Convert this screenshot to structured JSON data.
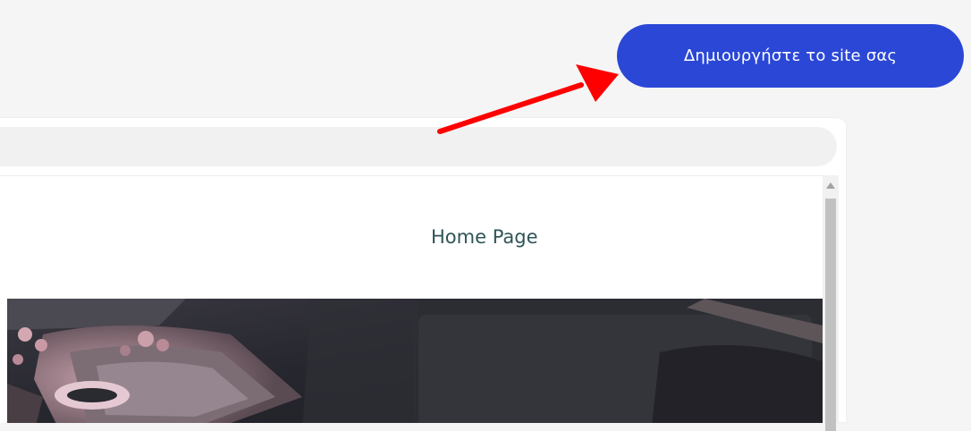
{
  "header": {
    "cta_label": "Δημιουργήστε το site σας"
  },
  "preview": {
    "address_value": "",
    "nav": {
      "home_link": "Home Page"
    },
    "hero": {
      "image": "hero-photo"
    }
  },
  "annotation": {
    "icon": "red-arrow-icon",
    "color": "#ff0000"
  },
  "colors": {
    "cta": "#2a47d6",
    "nav_link": "#2f5556",
    "background": "#f5f5f5"
  }
}
